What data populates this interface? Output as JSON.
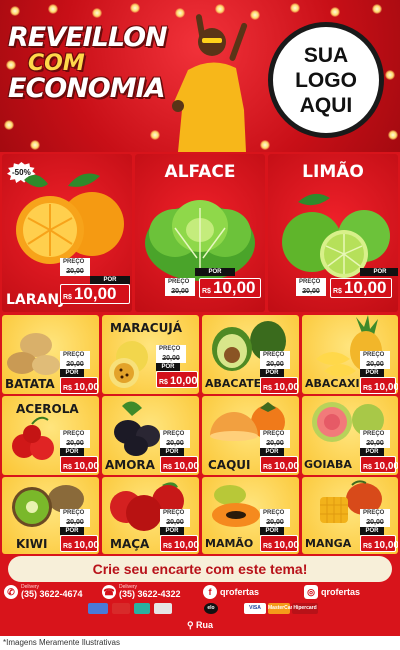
{
  "header": {
    "title_line1": "REVEILLON",
    "title_line2": "COM",
    "title_line3": "ECONOMIA",
    "logo_line1": "SUA",
    "logo_line2": "LOGO",
    "logo_line3": "AQUI"
  },
  "colors": {
    "brand_red": "#d4101a",
    "yellow": "#fbc533",
    "dark": "#111111"
  },
  "labels": {
    "preco": "PREÇO",
    "por": "POR",
    "currency": "R$"
  },
  "top_products": [
    {
      "name": "LARANJA",
      "badge": "-50%",
      "old_price": "20,00",
      "price": "10,00",
      "icon": "orange-icon"
    },
    {
      "name": "ALFACE",
      "old_price": "20,00",
      "price": "10,00",
      "icon": "lettuce-icon"
    },
    {
      "name": "LIMÃO",
      "old_price": "20,00",
      "price": "10,00",
      "icon": "lime-icon"
    }
  ],
  "products": [
    {
      "name": "BATATA",
      "old_price": "20,00",
      "price": "10,00",
      "icon": "potato-icon"
    },
    {
      "name": "MARACUJÁ",
      "old_price": "20,00",
      "price": "10,00",
      "icon": "passion-fruit-icon"
    },
    {
      "name": "ABACATE",
      "old_price": "20,00",
      "price": "10,00",
      "icon": "avocado-icon"
    },
    {
      "name": "ABACAXI",
      "old_price": "20,00",
      "price": "10,00",
      "icon": "pineapple-icon"
    },
    {
      "name": "ACEROLA",
      "old_price": "20,00",
      "price": "10,00",
      "icon": "acerola-icon"
    },
    {
      "name": "AMORA",
      "old_price": "20,00",
      "price": "10,00",
      "icon": "blackberry-icon"
    },
    {
      "name": "CAQUI",
      "old_price": "20,00",
      "price": "10,00",
      "icon": "persimmon-icon"
    },
    {
      "name": "GOIABA",
      "old_price": "20,00",
      "price": "10,00",
      "icon": "guava-icon"
    },
    {
      "name": "KIWI",
      "old_price": "20,00",
      "price": "10,00",
      "icon": "kiwi-icon"
    },
    {
      "name": "MAÇA",
      "old_price": "20,00",
      "price": "10,00",
      "icon": "apple-icon"
    },
    {
      "name": "MAMÃO",
      "old_price": "20,00",
      "price": "10,00",
      "icon": "papaya-icon"
    },
    {
      "name": "MANGA",
      "old_price": "20,00",
      "price": "10,00",
      "icon": "mango-icon"
    }
  ],
  "footer": {
    "cta": "Crie seu encarte com este tema!",
    "whatsapp_label": "Delivery",
    "whatsapp_number": "(35) 3622-4674",
    "phone_label": "Delivery",
    "phone_number": "(35) 3622-4322",
    "facebook": "qrofertas",
    "instagram": "qrofertas",
    "payments": [
      "VISA",
      "MasterCard",
      "Hipercard",
      "elo"
    ],
    "address": "Rua",
    "disclaimer": "*Imagens Meramente Ilustrativas"
  }
}
